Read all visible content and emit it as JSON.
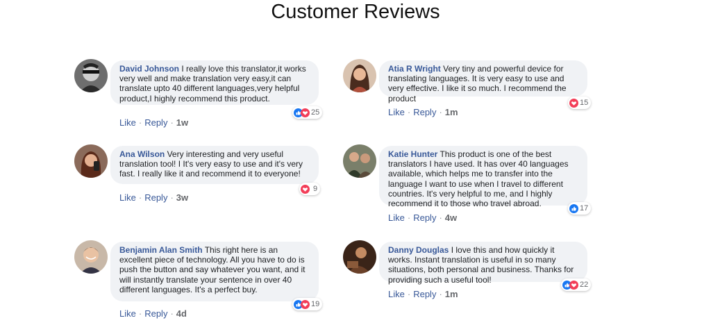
{
  "page": {
    "title": "Customer Reviews"
  },
  "comments": [
    {
      "author": "David Johnson",
      "text": "I really love this translator,it works very well and make translation very easy,it can translate upto 40 different languages,very helpful product,I highly recommend this product.",
      "reactions": [
        "like",
        "love"
      ],
      "count": "25",
      "like": "Like",
      "reply": "Reply",
      "time": "1w"
    },
    {
      "author": "Atia R Wright",
      "text": "Very tiny and powerful device for translating languages. It is very easy to use and very effective. I like it so much. I recommend the product",
      "reactions": [
        "love"
      ],
      "count": "15",
      "like": "Like",
      "reply": "Reply",
      "time": "1m"
    },
    {
      "author": "Ana Wilson",
      "text": "Very interesting and very useful translation tool! I It's very easy to use and it's very fast. I really like it and recommend it to everyone!",
      "reactions": [
        "love"
      ],
      "count": "9",
      "like": "Like",
      "reply": "Reply",
      "time": "3w"
    },
    {
      "author": "Katie Hunter",
      "text": "This product is one of the best translators I have used. It has over 40 languages available, which helps me to transfer into the language I want to use when I travel to different countries. It's very helpful to me, and I highly recommend it to those who travel abroad.",
      "reactions": [
        "like"
      ],
      "count": "17",
      "like": "Like",
      "reply": "Reply",
      "time": "4w"
    },
    {
      "author": "Benjamin Alan Smith",
      "text": "This right here is an excellent piece of technology. All you have to do is push the button and say whatever you want, and it will instantly translate your sentence in over 40 different languages. It's a perfect buy.",
      "reactions": [
        "like",
        "love"
      ],
      "count": "19",
      "like": "Like",
      "reply": "Reply",
      "time": "4d"
    },
    {
      "author": "Danny Douglas",
      "text": "I love this and how quickly it works. Instant translation is useful in so many situations, both personal and business. Thanks for providing such a useful tool!",
      "reactions": [
        "like",
        "love"
      ],
      "count": "22",
      "like": "Like",
      "reply": "Reply",
      "time": "1m"
    }
  ],
  "colors": {
    "author": "#385898",
    "bubble": "#f0f2f5",
    "like": "#1877f2",
    "love": "#f33e58"
  }
}
